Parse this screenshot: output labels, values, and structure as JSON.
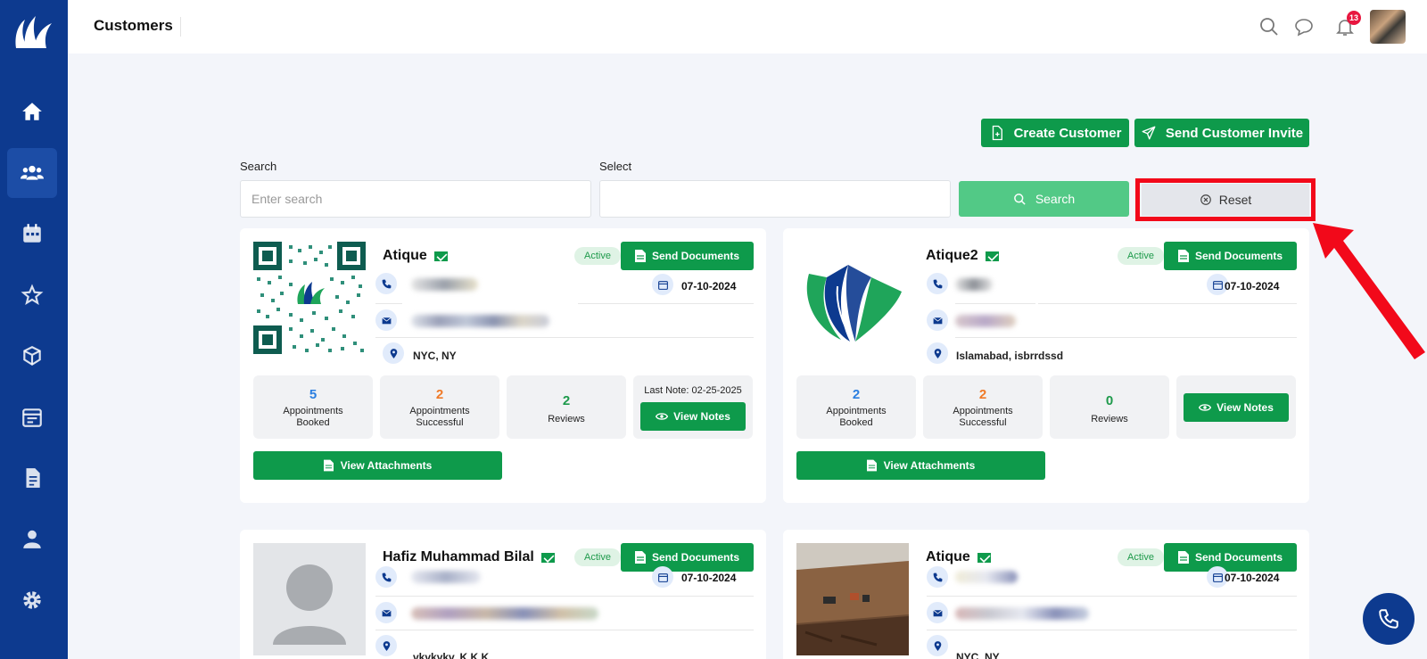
{
  "header": {
    "title": "Customers",
    "notification_count": "13"
  },
  "sidebar": {
    "items": [
      {
        "icon": "home-icon"
      },
      {
        "icon": "users-icon"
      },
      {
        "icon": "calendar-icon"
      },
      {
        "icon": "star-icon"
      },
      {
        "icon": "box-icon"
      },
      {
        "icon": "schedule-icon"
      },
      {
        "icon": "document-icon"
      },
      {
        "icon": "user-icon"
      },
      {
        "icon": "gear-icon"
      }
    ],
    "active_index": 1
  },
  "actions": {
    "create_customer": "Create Customer",
    "send_invite": "Send Customer Invite"
  },
  "filters": {
    "search_label": "Search",
    "search_placeholder": "Enter search",
    "select_label": "Select",
    "search_button": "Search",
    "reset_button": "Reset"
  },
  "colors": {
    "sidebar": "#0d3a8f",
    "primary_green": "#0e9a4b",
    "highlight_red": "#f2091a"
  },
  "customers": [
    {
      "name": "Atique",
      "status": "Active",
      "send_docs": "Send Documents",
      "date": "07-10-2024",
      "location": "NYC, NY",
      "stats": {
        "booked": "5",
        "booked_label": "Appointments Booked",
        "successful": "2",
        "successful_label": "Appointments Successful",
        "reviews": "2",
        "reviews_label": "Reviews"
      },
      "last_note": "Last Note: 02-25-2025",
      "view_notes": "View Notes",
      "view_attachments": "View Attachments"
    },
    {
      "name": "Atique2",
      "status": "Active",
      "send_docs": "Send Documents",
      "date": "07-10-2024",
      "location": "Islamabad, isbrrdssd",
      "stats": {
        "booked": "2",
        "booked_label": "Appointments Booked",
        "successful": "2",
        "successful_label": "Appointments Successful",
        "reviews": "0",
        "reviews_label": "Reviews"
      },
      "view_notes": "View Notes",
      "view_attachments": "View Attachments"
    },
    {
      "name": "Hafiz Muhammad Bilal",
      "status": "Active",
      "send_docs": "Send Documents",
      "date": "07-10-2024",
      "location": "vkvkvkv, K K K"
    },
    {
      "name": "Atique",
      "status": "Active",
      "send_docs": "Send Documents",
      "date": "07-10-2024",
      "location": "NYC, NY"
    }
  ]
}
